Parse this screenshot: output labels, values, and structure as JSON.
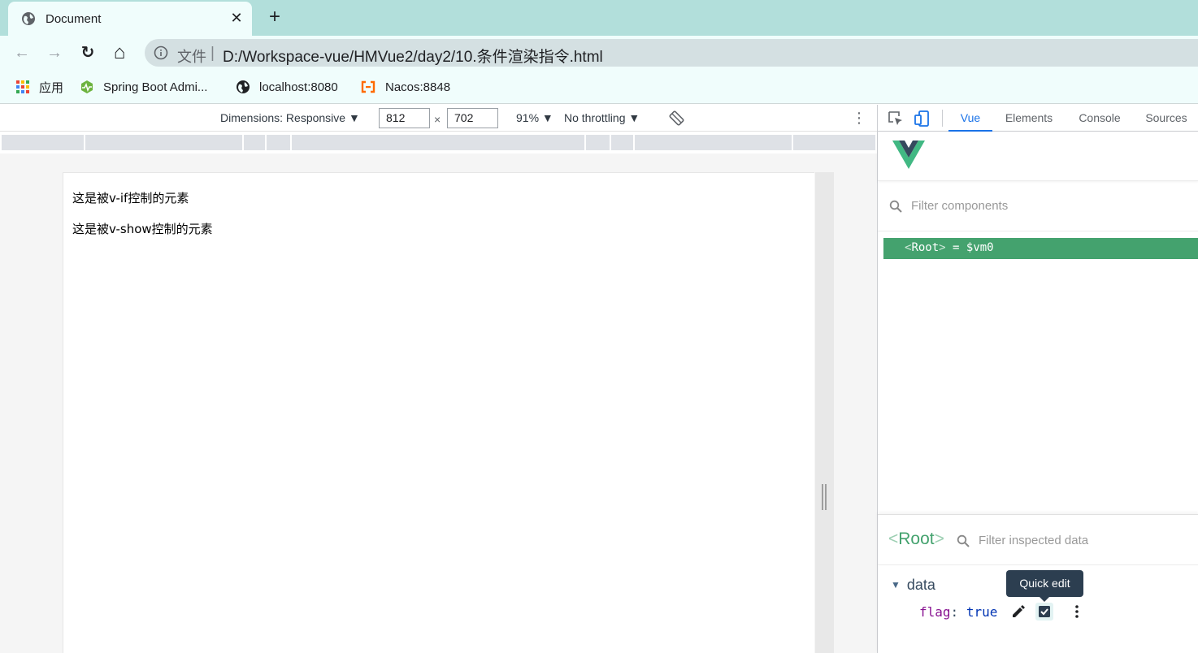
{
  "browser": {
    "tab": {
      "title": "Document",
      "close": "✕"
    },
    "new_tab": "+",
    "nav": {
      "back": "←",
      "forward": "→",
      "reload": "↻",
      "home": "⌂"
    },
    "address": {
      "scheme_label": "文件",
      "separator": "|",
      "url": "D:/Workspace-vue/HMVue2/day2/10.条件渲染指令.html"
    },
    "bookmarks": [
      {
        "label": "应用",
        "icon": "apps-grid-icon"
      },
      {
        "label": "Spring Boot Admi...",
        "icon": "spring-boot-admin-icon"
      },
      {
        "label": "localhost:8080",
        "icon": "globe-icon"
      },
      {
        "label": "Nacos:8848",
        "icon": "nacos-icon"
      }
    ]
  },
  "device_toolbar": {
    "dimensions": "Dimensions: Responsive ▼",
    "width": "812",
    "times": "×",
    "height": "702",
    "zoom": "91% ▼",
    "throttling": "No throttling ▼",
    "more": "⋮"
  },
  "page": {
    "lines": [
      "这是被v-if控制的元素",
      "这是被v-show控制的元素"
    ]
  },
  "devtools": {
    "tabs": [
      {
        "label": "Vue",
        "active": true
      },
      {
        "label": "Elements",
        "active": false
      },
      {
        "label": "Console",
        "active": false
      },
      {
        "label": "Sources",
        "active": false
      }
    ],
    "vue": {
      "filter_components_placeholder": "Filter components",
      "tree": {
        "open": "<",
        "name": "Root",
        "close": ">",
        "assign": " = ",
        "vm": "$vm0"
      },
      "inspector": {
        "open": "<",
        "name": "Root",
        "close": ">",
        "filter_placeholder": "Filter inspected data",
        "section": "data",
        "prop_key": "flag",
        "prop_colon": ":",
        "prop_value": "true",
        "tooltip": "Quick edit"
      }
    }
  },
  "colors": {
    "vue_green": "#44a26e",
    "tab_strip": "#b2dfdb",
    "chrome_bg": "#f0fdfc",
    "devtools_accent": "#1a73e8"
  }
}
